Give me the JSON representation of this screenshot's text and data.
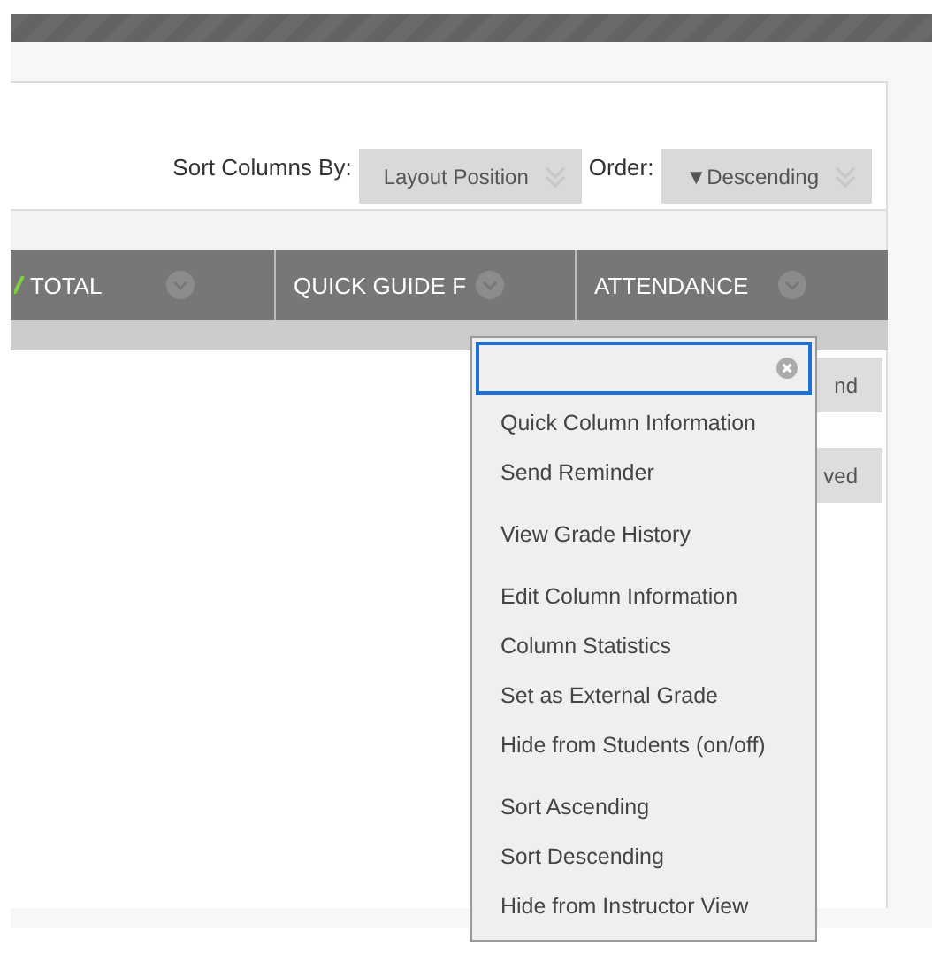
{
  "sort_bar": {
    "sort_label": "Sort Columns By:",
    "sort_value": "Layout Position",
    "order_label": "Order:",
    "order_value": "▼Descending"
  },
  "columns": [
    {
      "label": "TOTAL",
      "checked": true
    },
    {
      "label": "QUICK GUIDE F",
      "checked": false
    },
    {
      "label": "ATTENDANCE",
      "checked": false
    }
  ],
  "side_buttons": [
    "nd",
    "ved"
  ],
  "menu": {
    "groups": [
      [
        "Quick Column Information",
        "Send Reminder"
      ],
      [
        "View Grade History"
      ],
      [
        "Edit Column Information",
        "Column Statistics",
        "Set as External Grade",
        "Hide from Students (on/off)"
      ],
      [
        "Sort Ascending",
        "Sort Descending",
        "Hide from Instructor View"
      ]
    ]
  }
}
